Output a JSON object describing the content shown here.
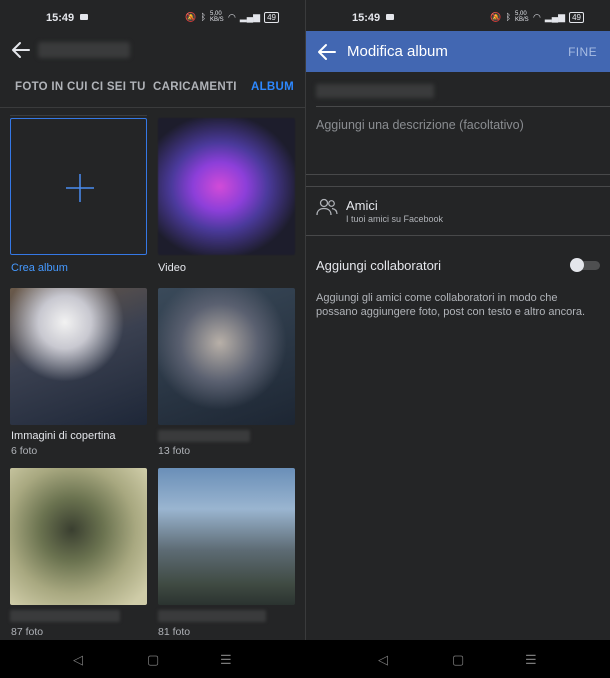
{
  "left": {
    "status": {
      "time": "15:49",
      "speed": "5,00 KB/S",
      "battery": "49"
    },
    "tabs": [
      "FOTO IN CUI CI SEI TU",
      "CARICAMENTI",
      "ALBUM"
    ],
    "active_tab": "ALBUM",
    "albums": [
      {
        "label": "Crea album",
        "count": ""
      },
      {
        "label": "Video",
        "count": ""
      },
      {
        "label": "Immagini di copertina",
        "count": "6 foto"
      },
      {
        "label": "",
        "count": "13 foto"
      },
      {
        "label": "",
        "count": "87 foto"
      },
      {
        "label": "",
        "count": "81 foto"
      }
    ]
  },
  "right": {
    "status": {
      "time": "15:49",
      "speed": "5,00 KB/S",
      "battery": "49"
    },
    "title": "Modifica album",
    "done": "FINE",
    "description_placeholder": "Aggiungi una descrizione (facoltativo)",
    "privacy": {
      "label": "Amici",
      "sub": "I tuoi amici su Facebook"
    },
    "collaborators": {
      "label": "Aggiungi collaboratori",
      "enabled": false,
      "description": "Aggiungi gli amici come collaboratori in modo che possano aggiungere foto, post con testo e altro ancora."
    }
  },
  "colors": {
    "accent": "#2d88ff",
    "header": "#4267b2",
    "background": "#242526"
  },
  "nav": [
    "back-triangle-icon",
    "home-square-icon",
    "menu-lines-icon"
  ]
}
